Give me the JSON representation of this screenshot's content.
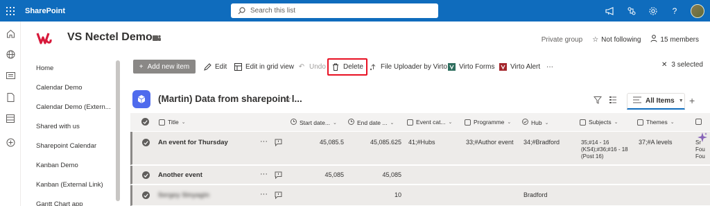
{
  "suite": {
    "app_name": "SharePoint",
    "search_placeholder": "Search this list",
    "icons": [
      "megaphone-icon",
      "share-icon",
      "settings-icon",
      "help-icon",
      "avatar"
    ]
  },
  "rail": {
    "icons": [
      "home-icon",
      "globe-icon",
      "news-icon",
      "document-icon",
      "list-icon",
      "add-icon"
    ]
  },
  "site": {
    "title": "VS Nectel Demo",
    "group_type": "Private group",
    "follow_label": "Not following",
    "members_label": "15 members"
  },
  "nav": {
    "items": [
      {
        "label": "Home"
      },
      {
        "label": "Calendar Demo"
      },
      {
        "label": "Calendar Demo (Extern..."
      },
      {
        "label": "Shared with us"
      },
      {
        "label": "Sharepoint Calendar"
      },
      {
        "label": "Kanban Demo"
      },
      {
        "label": "Kanban (External Link)"
      },
      {
        "label": "Gantt Chart app"
      }
    ]
  },
  "commands": {
    "add_new_item": "Add new item",
    "edit": "Edit",
    "edit_grid": "Edit in grid view",
    "undo": "Undo",
    "delete": "Delete",
    "file_uploader": "File Uploader by Virto",
    "virto_forms": "Virto Forms",
    "virto_alert": "Virto Alert",
    "more": "···",
    "selected": "3 selected"
  },
  "list": {
    "title": "(Martin) Data from sharepoint l...",
    "view_name": "All Items",
    "columns": [
      {
        "label": "Title"
      },
      {
        "label": "Start date..."
      },
      {
        "label": "End date ..."
      },
      {
        "label": "Event cat..."
      },
      {
        "label": "Programme"
      },
      {
        "label": "Hub"
      },
      {
        "label": "Subjects"
      },
      {
        "label": "Themes"
      }
    ],
    "rows": [
      {
        "title": "An event for Thursday",
        "start": "45,085.5",
        "end": "45,085.625",
        "category": "41;#Hubs",
        "programme": "33;#Author event",
        "hub": "34;#Bradford",
        "subjects": "35;#14 - 16 (KS4);#36;#16 - 18 (Post 16)",
        "themes": "37;#A levels",
        "extra": "Sr Fou Fou"
      },
      {
        "title": "Another event",
        "start": "45,085",
        "end": "45,085",
        "category": "",
        "programme": "",
        "hub": "",
        "subjects": "",
        "themes": "",
        "extra": ""
      },
      {
        "title": "Sergey Sinyagin",
        "start": "",
        "end": "10",
        "category": "",
        "programme": "",
        "hub": "Bradford",
        "subjects": "",
        "themes": "",
        "extra": ""
      }
    ]
  },
  "colors": {
    "suite_bar": "#0f6cbd",
    "list_icon": "#4f6bed",
    "delete_highlight": "#e81123",
    "row_selected": "#edebe9"
  }
}
